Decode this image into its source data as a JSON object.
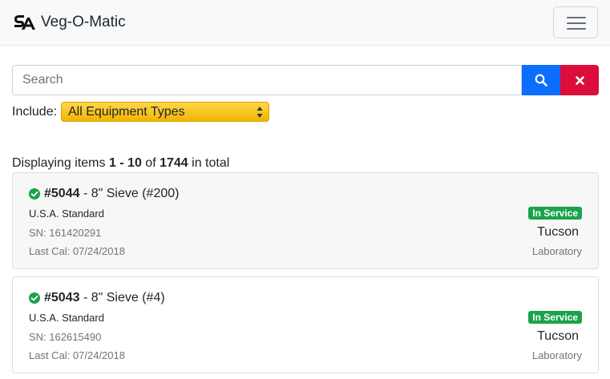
{
  "navbar": {
    "brand_text": "Veg-O-Matic",
    "logo_icon": "sa-logo-icon",
    "menu_icon": "hamburger-menu-icon"
  },
  "search": {
    "placeholder": "Search",
    "value": "",
    "search_button_icon": "search-icon",
    "clear_button_icon": "close-icon",
    "search_color": "#0d6efd",
    "clear_color": "#dc0d3a"
  },
  "filter": {
    "include_label": "Include:",
    "selected": "All Equipment Types",
    "color": "#f5c518"
  },
  "summary": {
    "prefix": "Displaying items ",
    "range": "1 - 10",
    "of": " of ",
    "total": "1744",
    "suffix": " in total"
  },
  "items": [
    {
      "id": "#5044",
      "title": " - 8\" Sieve (#200)",
      "standard": "U.S.A. Standard",
      "sn": "SN: 161420291",
      "last_cal": "Last Cal: 07/24/2018",
      "status": "In Service",
      "city": "Tucson",
      "dept": "Laboratory"
    },
    {
      "id": "#5043",
      "title": " - 8\" Sieve (#4)",
      "standard": "U.S.A. Standard",
      "sn": "SN: 162615490",
      "last_cal": "Last Cal: 07/24/2018",
      "status": "In Service",
      "city": "Tucson",
      "dept": "Laboratory"
    }
  ],
  "colors": {
    "status_green": "#1aa34a",
    "check_green": "#1aa34a"
  }
}
